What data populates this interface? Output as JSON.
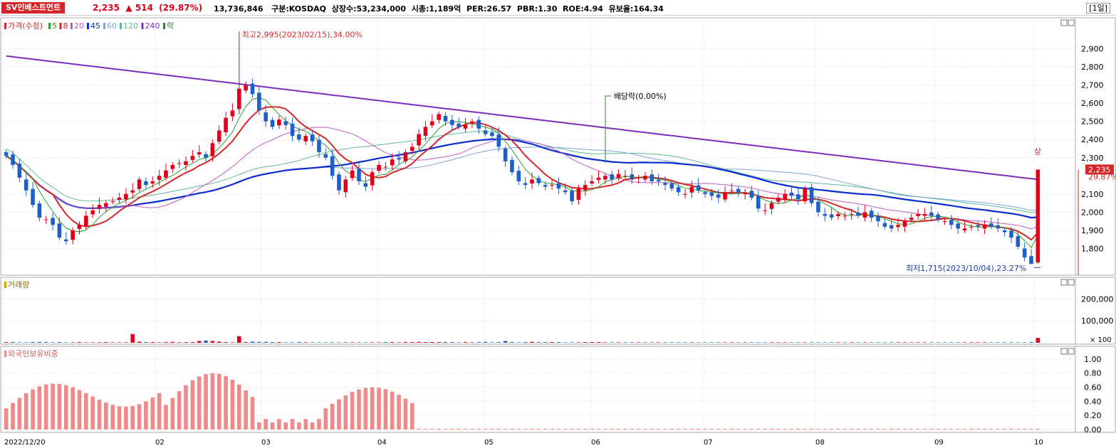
{
  "header": {
    "stock_name": "SV인베스트먼트",
    "price": "2,235",
    "change": "514",
    "change_pct": "(29.87%)",
    "volume": "13,736,846",
    "market_label": "구분:KOSDAQ",
    "shares_label": "상장수:53,234,000",
    "mcap_label": "시총:1,189억",
    "per_label": "PER:26.57",
    "pbr_label": "PBR:1.30",
    "roe_label": "ROE:4.94",
    "float_label": "유보율:164.34",
    "period": "[1일]"
  },
  "colors": {
    "up": "#e0001b",
    "down": "#1f5fc8",
    "ma5": "#2ca02c",
    "ma8": "#d62728",
    "ma20": "#c05cc0",
    "ma45": "#0a2bd0",
    "ma60": "#7aa6d6",
    "ma120": "#5fb896",
    "ma240": "#7b2fbf",
    "volume_up": "#e0001b",
    "volume_down": "#1f5fc8",
    "foreign": "#f08a8a"
  },
  "chart_data": [
    {
      "type": "candlestick",
      "legend": [
        "가격(수정)",
        "5",
        "8",
        "20",
        "45",
        "60",
        "120",
        "240",
        "락"
      ],
      "ylim": [
        1700,
        3000
      ],
      "y_ticks": [
        2900,
        2800,
        2700,
        2600,
        2500,
        2400,
        2300,
        2100,
        2000,
        1900,
        1800
      ],
      "x_tick_labels": [
        "2022/12/20",
        "02",
        "03",
        "04",
        "05",
        "06",
        "07",
        "08",
        "09",
        "10"
      ],
      "close": [
        2310,
        2260,
        2190,
        2120,
        2040,
        1970,
        1960,
        1930,
        1860,
        1840,
        1900,
        1930,
        1980,
        2010,
        2040,
        2050,
        2060,
        2080,
        2100,
        2120,
        2180,
        2150,
        2170,
        2200,
        2230,
        2260,
        2270,
        2280,
        2310,
        2330,
        2300,
        2380,
        2450,
        2520,
        2560,
        2680,
        2700,
        2650,
        2560,
        2500,
        2470,
        2510,
        2480,
        2420,
        2400,
        2420,
        2390,
        2330,
        2300,
        2200,
        2120,
        2180,
        2230,
        2170,
        2140,
        2220,
        2260,
        2250,
        2290,
        2290,
        2330,
        2360,
        2430,
        2470,
        2500,
        2540,
        2500,
        2480,
        2470,
        2480,
        2500,
        2460,
        2430,
        2420,
        2360,
        2280,
        2220,
        2170,
        2150,
        2180,
        2160,
        2140,
        2150,
        2130,
        2110,
        2060,
        2130,
        2150,
        2170,
        2190,
        2200,
        2180,
        2210,
        2200,
        2180,
        2190,
        2200,
        2170,
        2170,
        2150,
        2130,
        2110,
        2100,
        2140,
        2120,
        2100,
        2090,
        2080,
        2110,
        2120,
        2110,
        2110,
        2080,
        2020,
        2010,
        2050,
        2080,
        2100,
        2090,
        2070,
        2130,
        2050,
        2000,
        1980,
        1970,
        1990,
        1980,
        1990,
        1980,
        2000,
        1970,
        1950,
        1920,
        1910,
        1930,
        1950,
        1970,
        1990,
        1990,
        1980,
        1960,
        1950,
        1930,
        1910,
        1910,
        1920,
        1920,
        1930,
        1920,
        1910,
        1890,
        1860,
        1810,
        1750,
        1715,
        2235
      ],
      "high": 2995,
      "low": 1715,
      "annotations": [
        "최고2,995(2023/02/15),34.00%",
        "최저1,715(2023/10/04),23.27%",
        "배당락(0.00%)",
        "상",
        "29.87%"
      ]
    },
    {
      "type": "bar",
      "name": "거래량",
      "y_ticks": [
        "200,000",
        "100,000"
      ],
      "unit_label": "× 100",
      "values": [
        3,
        3,
        2,
        2,
        3,
        4,
        3,
        2,
        3,
        2,
        2,
        3,
        2,
        2,
        2,
        3,
        2,
        2,
        2,
        40,
        5,
        3,
        3,
        2,
        3,
        4,
        2,
        3,
        3,
        8,
        10,
        8,
        5,
        3,
        2,
        30,
        3,
        5,
        4,
        4,
        3,
        3,
        2,
        2,
        3,
        2,
        2,
        2,
        2,
        2,
        2,
        2,
        2,
        2,
        2,
        2,
        2,
        3,
        3,
        2,
        3,
        3,
        4,
        3,
        3,
        3,
        3,
        3,
        2,
        3,
        2,
        3,
        4,
        2,
        3,
        8,
        3,
        2,
        3,
        4,
        3,
        3,
        3,
        3,
        2,
        2,
        2,
        3,
        3,
        3,
        2,
        2,
        2,
        2,
        2,
        2,
        2,
        2,
        2,
        2,
        2,
        2,
        2,
        2,
        2,
        2,
        2,
        2,
        2,
        2,
        2,
        2,
        2,
        2,
        2,
        2,
        2,
        2,
        2,
        2,
        2,
        2,
        2,
        2,
        2,
        2,
        2,
        2,
        2,
        2,
        2,
        2,
        2,
        2,
        2,
        2,
        2,
        2,
        2,
        2,
        2,
        2,
        2,
        2,
        2,
        2,
        2,
        2,
        2,
        2,
        2,
        2,
        2,
        2,
        3,
        22
      ]
    },
    {
      "type": "bar",
      "name": "외국인보유비중",
      "ylim": [
        0,
        1.1
      ],
      "y_ticks": [
        "1.00",
        "0.80",
        "0.60",
        "0.40",
        "0.20",
        "0.00"
      ]
    }
  ]
}
